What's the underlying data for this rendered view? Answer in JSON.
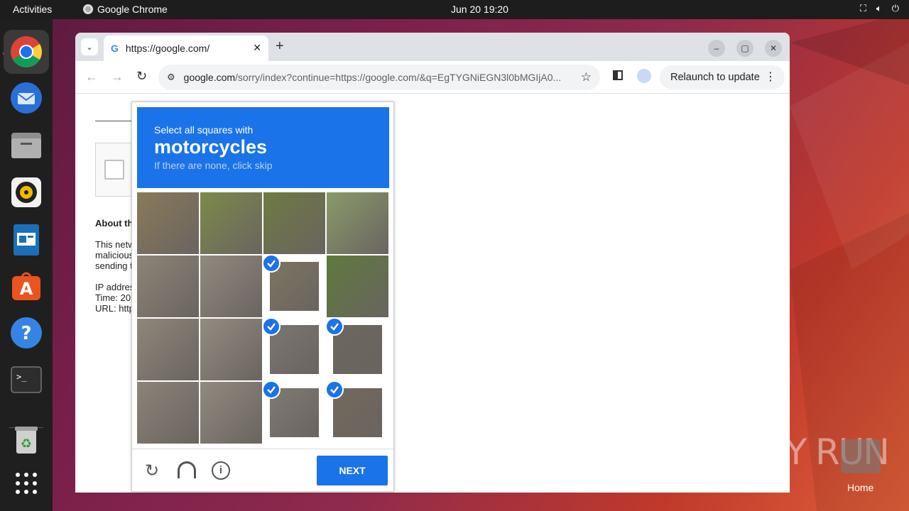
{
  "topbar": {
    "activities": "Activities",
    "app_name": "Google Chrome",
    "clock": "Jun 20  19:20"
  },
  "dock": {
    "items": [
      "chrome-icon",
      "thunderbird-icon",
      "files-icon",
      "rhythmbox-icon",
      "libreoffice-impress-icon",
      "app-center-icon",
      "help-icon",
      "terminal-icon",
      "trash-icon",
      "show-apps-icon"
    ]
  },
  "browser": {
    "tab_title": "https://google.com/",
    "url_host": "google.com",
    "url_path": "/sorry/index?continue=https://google.com/&q=EgTYGNiEGN3l0bMGIjA0...",
    "relaunch_label": "Relaunch to update"
  },
  "page": {
    "about_heading": "About th",
    "para_line1": "This netw",
    "para_line2": "malicious",
    "para_line3": "sending t",
    "ip_line": "IP addres",
    "time_line": "Time: 20",
    "url_line": "URL: http"
  },
  "captcha": {
    "instruction": "Select all squares with",
    "target": "motorcycles",
    "hint": "If there are none, click skip",
    "next_label": "NEXT",
    "selected_tiles": [
      6,
      10,
      11,
      14,
      15
    ]
  },
  "desktop": {
    "watermark": "ANY RUN",
    "home_label": "Home"
  },
  "colors": {
    "accent": "#1a73e8",
    "ubuntu_orange": "#e95420"
  }
}
